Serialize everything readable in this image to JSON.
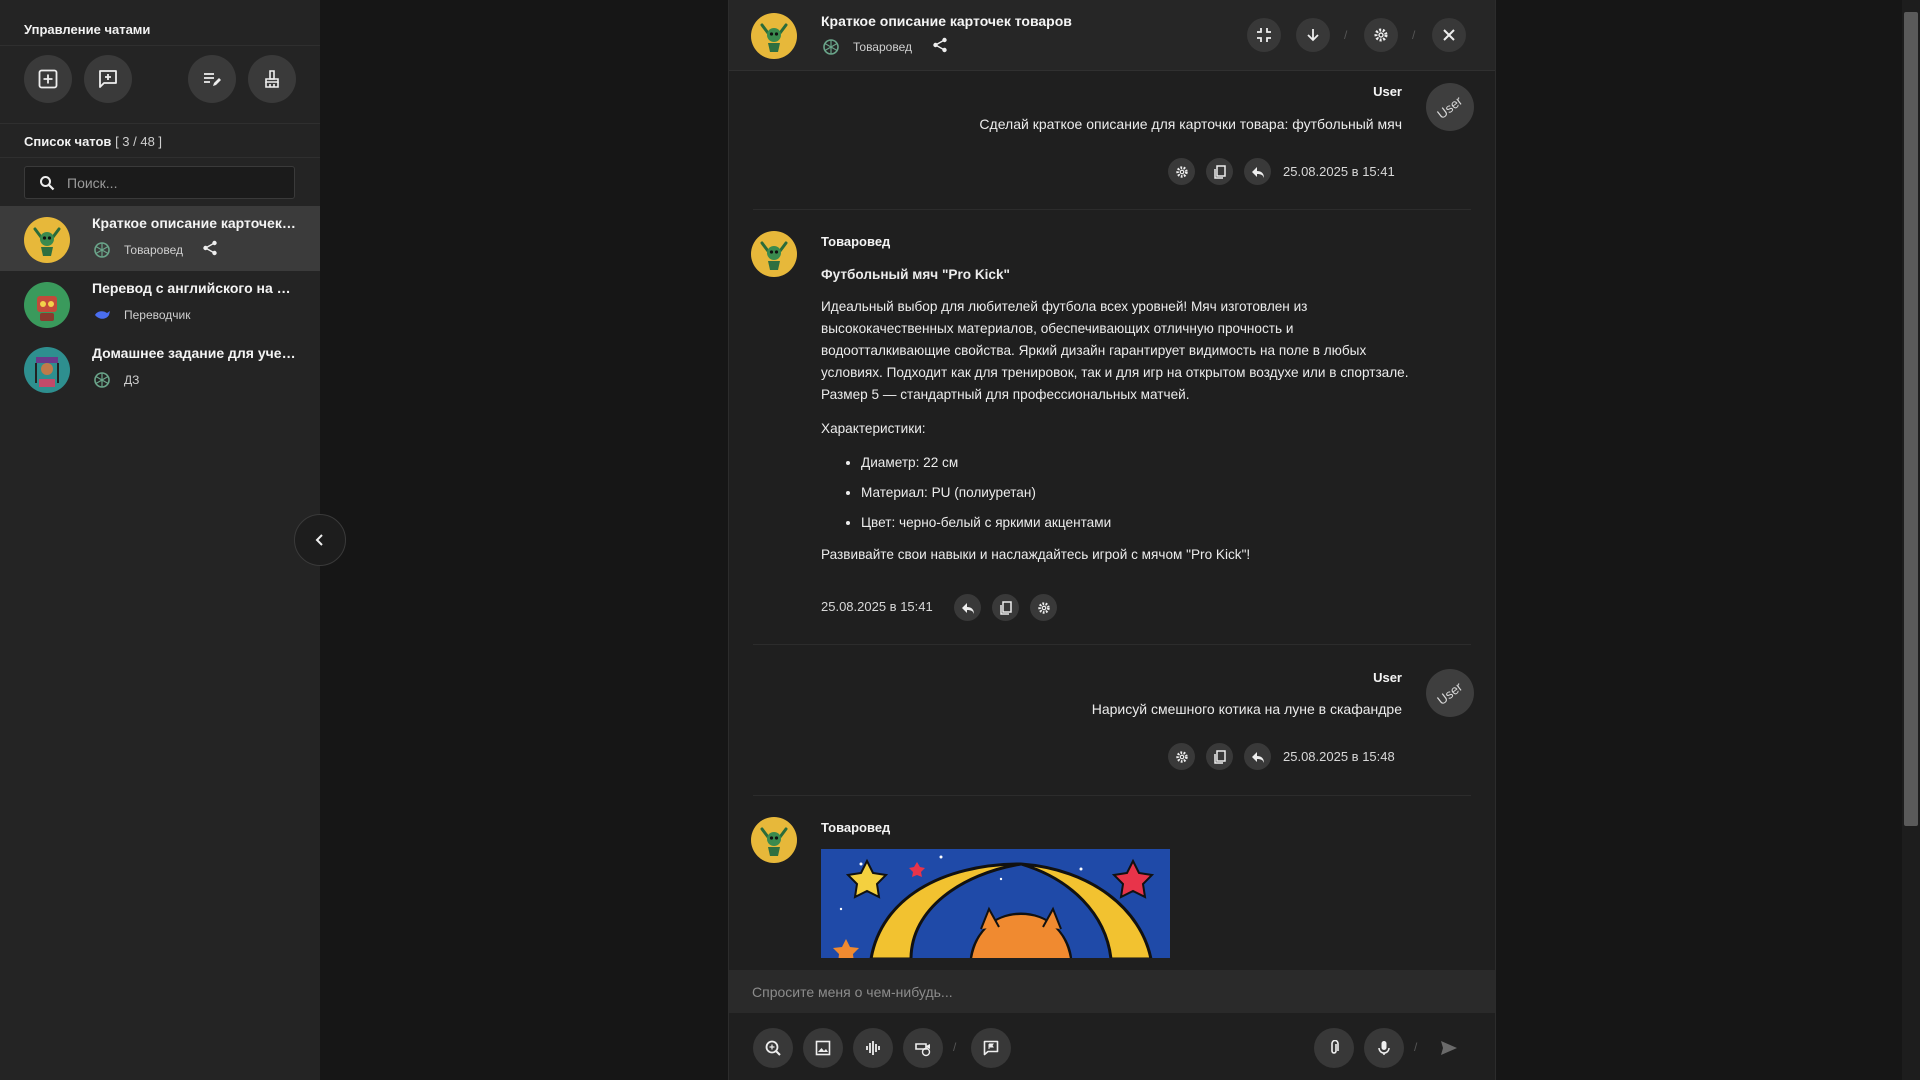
{
  "sidebar": {
    "title": "Управление чатами",
    "list_title": "Список чатов",
    "list_count": "[ 3 / 48 ]",
    "search_placeholder": "Поиск...",
    "chats": [
      {
        "title": "Краткое описание карточек товаров",
        "model": "Товаровед",
        "active": true
      },
      {
        "title": "Перевод с английского на русский",
        "model": "Переводчик",
        "active": false
      },
      {
        "title": "Домашнее задание для ученика",
        "model": "ДЗ",
        "active": false
      }
    ]
  },
  "header": {
    "title": "Краткое описание карточек товаров",
    "model": "Товаровед"
  },
  "messages": {
    "user1": {
      "name": "User",
      "avatar_text": "User",
      "text": "Сделай краткое описание для карточки товара: футбольный мяч",
      "timestamp": "25.08.2025 в 15:41"
    },
    "bot1": {
      "name": "Товаровед",
      "heading": "Футбольный мяч \"Pro Kick\"",
      "paragraph1": "Идеальный выбор для любителей футбола всех уровней! Мяч изготовлен из высококачественных материалов, обеспечивающих отличную прочность и водоотталкивающие свойства. Яркий дизайн гарантирует видимость на поле в любых условиях. Подходит как для тренировок, так и для игр на открытом воздухе или в спортзале. Размер 5 — стандартный для профессиональных матчей.",
      "features_title": "Характеристики:",
      "features": [
        "Диаметр: 22 см",
        "Материал: PU (полиуретан)",
        "Цвет: черно-белый с яркими акцентами"
      ],
      "closing": "Развивайте свои навыки и наслаждайтесь игрой с мячом \"Pro Kick\"!",
      "timestamp": "25.08.2025 в 15:41"
    },
    "user2": {
      "name": "User",
      "avatar_text": "User",
      "text": "Нарисуй смешного котика на луне в скафандре",
      "timestamp": "25.08.2025 в 15:48"
    },
    "bot2": {
      "name": "Товаровед"
    }
  },
  "input": {
    "placeholder": "Спросите меня о чем-нибудь..."
  },
  "colors": {
    "accent_gold": "#e7b83a",
    "avatar_green": "#3a9a5c",
    "avatar_teal": "#2e8f8f"
  }
}
